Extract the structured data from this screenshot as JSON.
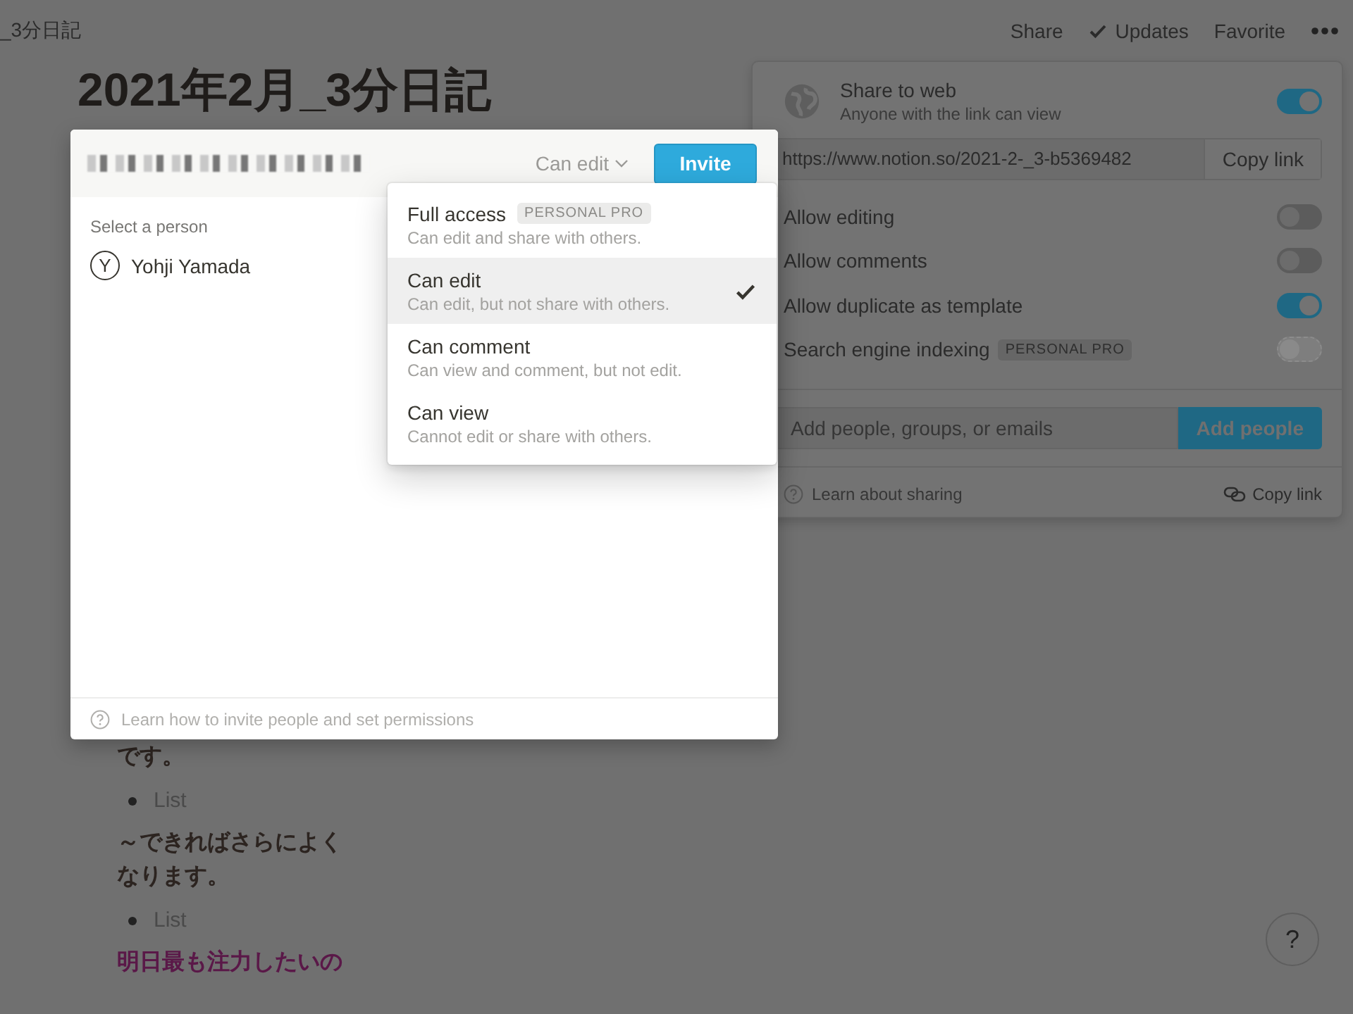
{
  "breadcrumb": "_3分日記",
  "topbar": {
    "items": [
      {
        "label": "Share",
        "kind": "text"
      },
      {
        "label": "Updates",
        "kind": "check"
      },
      {
        "label": "Favorite",
        "kind": "text"
      }
    ]
  },
  "page": {
    "title": "2021年2月_3分日記",
    "blocks": [
      {
        "kind": "text",
        "text": "です。"
      },
      {
        "kind": "bullet",
        "text": "List"
      },
      {
        "kind": "text",
        "text": "～できればさらによくなります。"
      },
      {
        "kind": "bullet",
        "text": "List"
      },
      {
        "kind": "accent",
        "text": "明日最も注力したいの"
      }
    ]
  },
  "share_panel": {
    "title": "Share to web",
    "subtitle": "Anyone with the link can view",
    "on": true,
    "url": "https://www.notion.so/2021-2-_3-b5369482",
    "copy_button": "Copy link",
    "options": [
      {
        "label": "Allow editing",
        "on": false,
        "disabled": false
      },
      {
        "label": "Allow comments",
        "on": false,
        "disabled": false
      },
      {
        "label": "Allow duplicate as template",
        "on": true,
        "disabled": false
      },
      {
        "label": "Search engine indexing",
        "badge": "PERSONAL PRO",
        "on": false,
        "disabled": true
      }
    ],
    "add": {
      "placeholder": "Add people, groups, or emails",
      "button": "Add people"
    },
    "footer": {
      "help": "Learn about sharing",
      "copy": "Copy link"
    }
  },
  "invite_dialog": {
    "permission": "Can edit",
    "button": "Invite",
    "section_label": "Select a person",
    "people": [
      {
        "initial": "Y",
        "name": "Yohji Yamada"
      }
    ],
    "footer": "Learn how to invite people and set permissions"
  },
  "permission_menu": {
    "items": [
      {
        "title": "Full access",
        "badge": "PERSONAL PRO",
        "description": "Can edit and share with others.",
        "selected": false
      },
      {
        "title": "Can edit",
        "description": "Can edit, but not share with others.",
        "selected": true
      },
      {
        "title": "Can comment",
        "description": "Can view and comment, but not edit.",
        "selected": false
      },
      {
        "title": "Can view",
        "description": "Cannot edit or share with others.",
        "selected": false
      }
    ]
  },
  "help_button": "?"
}
